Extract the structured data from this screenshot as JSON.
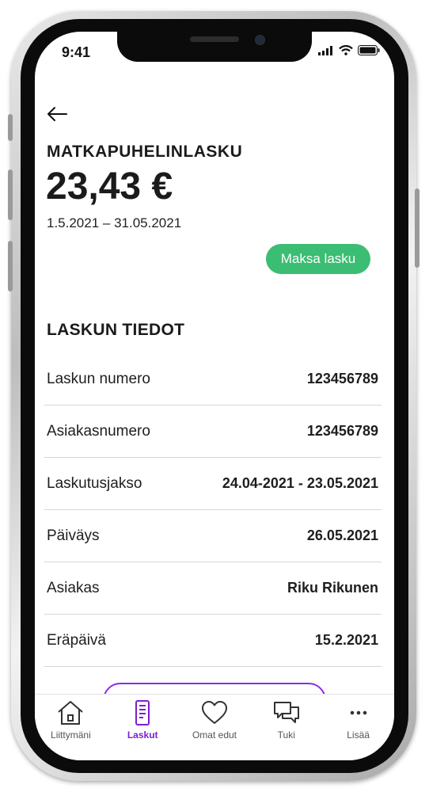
{
  "status_bar": {
    "time": "9:41"
  },
  "bill": {
    "type": "MATKAPUHELINLASKU",
    "amount": "23,43 €",
    "period": "1.5.2021 – 31.05.2021",
    "pay_button": "Maksa lasku"
  },
  "details": {
    "title": "LASKUN TIEDOT",
    "rows": [
      {
        "label": "Laskun numero",
        "value": "123456789"
      },
      {
        "label": "Asiakasnumero",
        "value": "123456789"
      },
      {
        "label": "Laskutusjakso",
        "value": "24.04-2021 - 23.05.2021"
      },
      {
        "label": "Päiväys",
        "value": "26.05.2021"
      },
      {
        "label": "Asiakas",
        "value": "Riku Rikunen"
      },
      {
        "label": "Eräpäivä",
        "value": "15.2.2021"
      }
    ]
  },
  "tabbar": {
    "items": [
      {
        "label": "Liittymäni",
        "icon": "house-icon"
      },
      {
        "label": "Laskut",
        "icon": "invoice-icon",
        "active": true
      },
      {
        "label": "Omat edut",
        "icon": "heart-icon"
      },
      {
        "label": "Tuki",
        "icon": "chat-bubbles-icon"
      },
      {
        "label": "Lisää",
        "icon": "more-dots-icon"
      }
    ]
  },
  "colors": {
    "accent_green": "#3bbd73",
    "accent_purple": "#7b1fd1"
  }
}
